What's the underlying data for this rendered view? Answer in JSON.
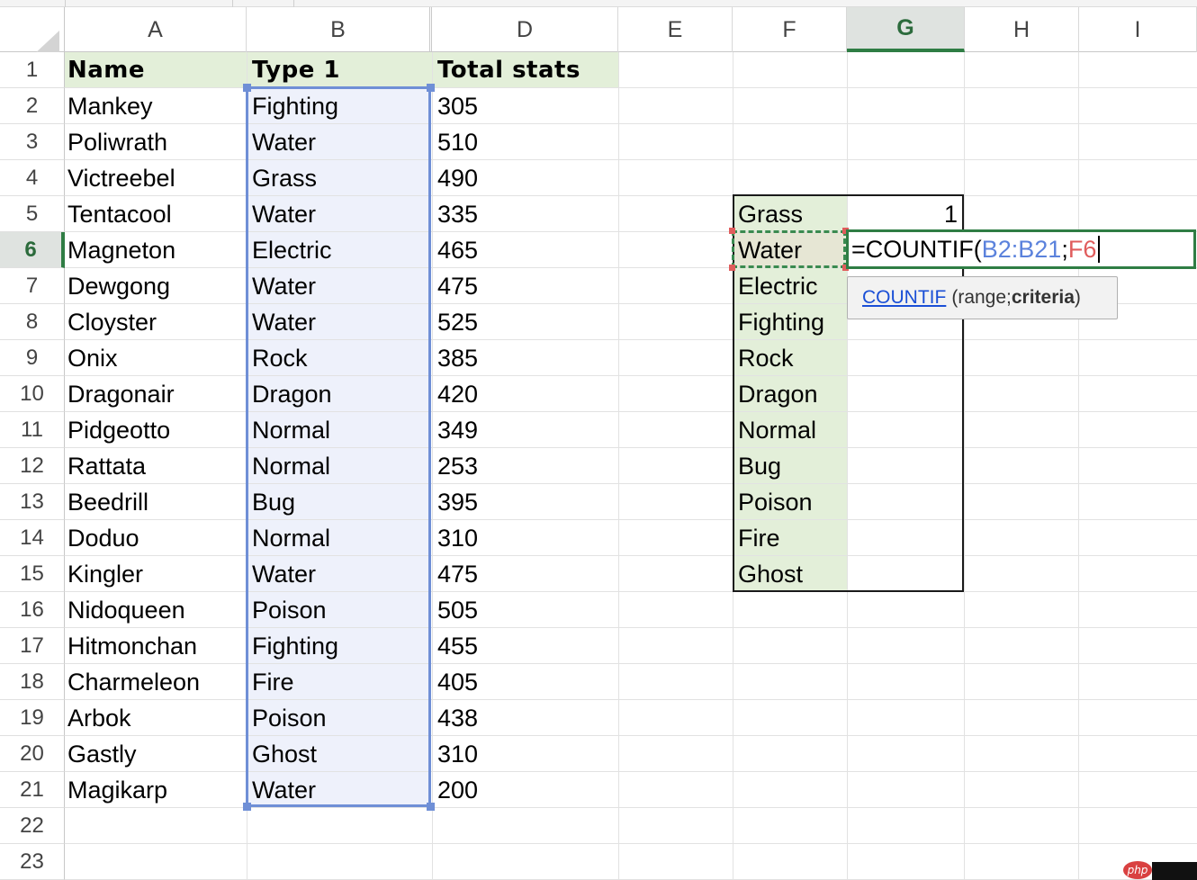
{
  "columns": [
    "A",
    "B",
    "D",
    "E",
    "F",
    "G",
    "H",
    "I"
  ],
  "active_column": "G",
  "rows": [
    "1",
    "2",
    "3",
    "4",
    "5",
    "6",
    "7",
    "8",
    "9",
    "10",
    "11",
    "12",
    "13",
    "14",
    "15",
    "16",
    "17",
    "18",
    "19",
    "20",
    "21",
    "22",
    "23"
  ],
  "active_row": "6",
  "headers": {
    "name": "Name",
    "type1": "Type 1",
    "total": "Total stats"
  },
  "table": [
    {
      "name": "Mankey",
      "type": "Fighting",
      "total": "305"
    },
    {
      "name": "Poliwrath",
      "type": "Water",
      "total": "510"
    },
    {
      "name": "Victreebel",
      "type": "Grass",
      "total": "490"
    },
    {
      "name": "Tentacool",
      "type": "Water",
      "total": "335"
    },
    {
      "name": "Magneton",
      "type": "Electric",
      "total": "465"
    },
    {
      "name": "Dewgong",
      "type": "Water",
      "total": "475"
    },
    {
      "name": "Cloyster",
      "type": "Water",
      "total": "525"
    },
    {
      "name": "Onix",
      "type": "Rock",
      "total": "385"
    },
    {
      "name": "Dragonair",
      "type": "Dragon",
      "total": "420"
    },
    {
      "name": "Pidgeotto",
      "type": "Normal",
      "total": "349"
    },
    {
      "name": "Rattata",
      "type": "Normal",
      "total": "253"
    },
    {
      "name": "Beedrill",
      "type": "Bug",
      "total": "395"
    },
    {
      "name": "Doduo",
      "type": "Normal",
      "total": "310"
    },
    {
      "name": "Kingler",
      "type": "Water",
      "total": "475"
    },
    {
      "name": "Nidoqueen",
      "type": "Poison",
      "total": "505"
    },
    {
      "name": "Hitmonchan",
      "type": "Fighting",
      "total": "455"
    },
    {
      "name": "Charmeleon",
      "type": "Fire",
      "total": "405"
    },
    {
      "name": "Arbok",
      "type": "Poison",
      "total": "438"
    },
    {
      "name": "Gastly",
      "type": "Ghost",
      "total": "310"
    },
    {
      "name": "Magikarp",
      "type": "Water",
      "total": "200"
    }
  ],
  "type_list": [
    "Grass",
    "Water",
    "Electric",
    "Fighting",
    "Rock",
    "Dragon",
    "Normal",
    "Bug",
    "Poison",
    "Fire",
    "Ghost"
  ],
  "g5_value": "1",
  "formula": {
    "prefix": "=COUNTIF(",
    "range": "B2:B21",
    "sep": ";",
    "criteria": "F6"
  },
  "tooltip": {
    "fn": "COUNTIF",
    "args_open": "(range; ",
    "args_bold": "criteria",
    "args_close": ")"
  },
  "watermark": "php",
  "colors": {
    "accent_green": "#2f7d44",
    "selection_blue": "#6f8fd6",
    "criteria_red": "#e05c5c",
    "header_fill": "#e3efd9"
  }
}
